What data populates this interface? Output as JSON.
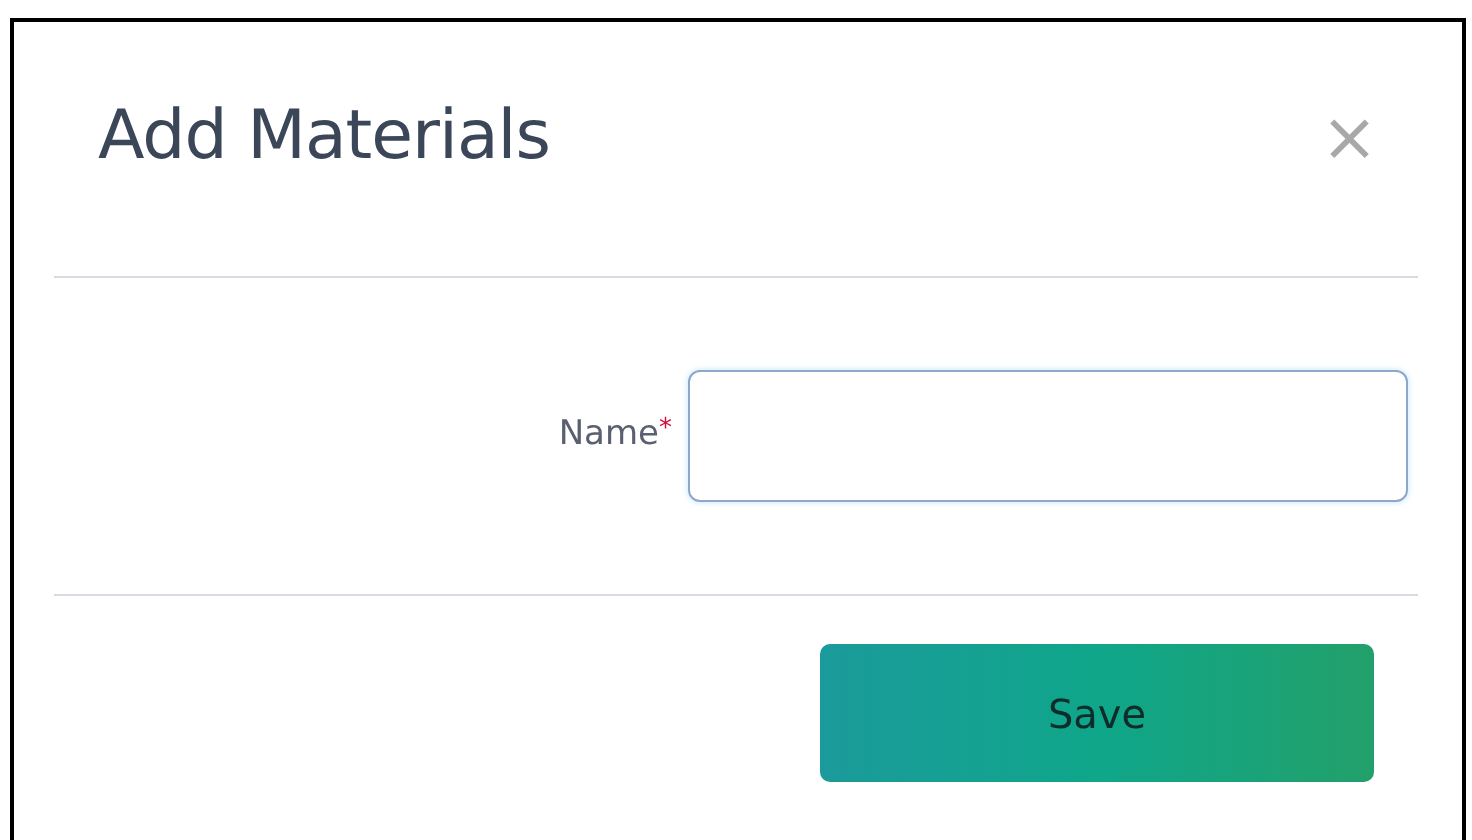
{
  "dialog": {
    "title": "Add Materials",
    "close": "×"
  },
  "fields": [
    {
      "label": "Name",
      "required_mark": "*"
    }
  ],
  "buttons": [
    {
      "label": "Save"
    }
  ]
}
